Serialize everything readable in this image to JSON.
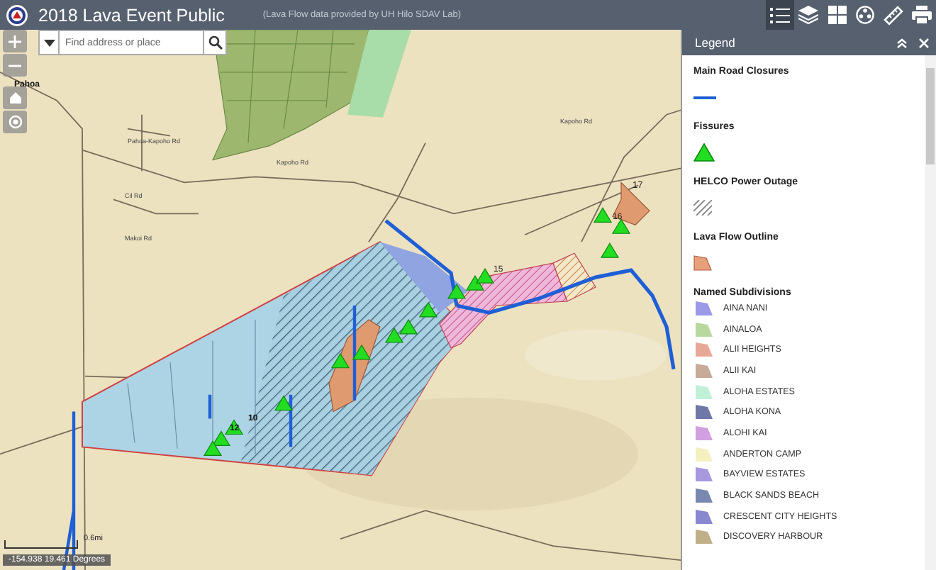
{
  "header": {
    "title": "2018 Lava Event Public",
    "subtitle": "(Lava Flow data provided by UH Hilo SDAV Lab)",
    "tools": [
      {
        "kind": "legend",
        "selected": true
      },
      {
        "kind": "layers",
        "selected": false
      },
      {
        "kind": "basemap",
        "selected": false
      },
      {
        "kind": "reel",
        "selected": false
      },
      {
        "kind": "measure",
        "selected": false
      },
      {
        "kind": "print",
        "selected": false
      }
    ]
  },
  "search": {
    "placeholder": "Find address or place"
  },
  "map": {
    "labels": [
      "Pahoa",
      "Pahoa-Kapoho Rd",
      "Kapoho Rd",
      "Cil Rd",
      "Makoi Rd",
      "Kapoho Rd",
      "17",
      "16",
      "15",
      "12",
      "10"
    ],
    "scale": "0.6mi",
    "coordinates": "-154.938 19.461 Degrees"
  },
  "legend": {
    "title": "Legend",
    "sections": [
      {
        "title": "Main Road Closures",
        "kind": "line",
        "color": "#1f5fd6"
      },
      {
        "title": "Fissures",
        "kind": "triangle",
        "color": "#22dd22"
      },
      {
        "title": "HELCO Power Outage",
        "kind": "hatch",
        "color": "#888888"
      },
      {
        "title": "Lava Flow Outline",
        "kind": "polygon",
        "color": "#e8a07a"
      },
      {
        "title": "Named Subdivisions",
        "kind": "list",
        "items": [
          {
            "label": "AINA NANI",
            "color": "#9a9ae8"
          },
          {
            "label": "AINALOA",
            "color": "#b8d8a0"
          },
          {
            "label": "ALII HEIGHTS",
            "color": "#e8a898"
          },
          {
            "label": "ALII KAI",
            "color": "#c8aa98"
          },
          {
            "label": "ALOHA ESTATES",
            "color": "#c0f0d8"
          },
          {
            "label": "ALOHA KONA",
            "color": "#7078a8"
          },
          {
            "label": "ALOHI KAI",
            "color": "#d0a0e0"
          },
          {
            "label": "ANDERTON CAMP",
            "color": "#f4f0c0"
          },
          {
            "label": "BAYVIEW ESTATES",
            "color": "#a898e0"
          },
          {
            "label": "BLACK SANDS BEACH",
            "color": "#7888b0"
          },
          {
            "label": "CRESCENT CITY HEIGHTS",
            "color": "#8888d0"
          },
          {
            "label": "DISCOVERY HARBOUR",
            "color": "#c0b088"
          }
        ]
      }
    ]
  }
}
